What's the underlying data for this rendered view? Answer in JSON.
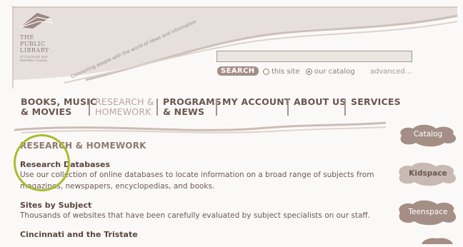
{
  "logo": {
    "line1": "THE",
    "line2": "PUBLIC",
    "line3": "LIBRARY",
    "sub": "of Cincinnati and Hamilton County",
    "tagline": "Connecting people with the world of ideas and information"
  },
  "search": {
    "button_label": "SEARCH",
    "input_value": "",
    "options": [
      {
        "label": "this site",
        "selected": false
      },
      {
        "label": "our catalog",
        "selected": true
      }
    ],
    "advanced_label": "advanced..."
  },
  "nav": {
    "items": [
      {
        "line1": "BOOKS, MUSIC",
        "line2": "& MOVIES",
        "active": false
      },
      {
        "line1": "RESEARCH &",
        "line2": "HOMEWORK",
        "active": true
      },
      {
        "line1": "PROGRAMS",
        "line2": "& NEWS",
        "active": false
      },
      {
        "line1": "MY ACCOUNT",
        "line2": "",
        "active": false
      },
      {
        "line1": "ABOUT US",
        "line2": "",
        "active": false
      },
      {
        "line1": "SERVICES",
        "line2": "",
        "active": false
      }
    ]
  },
  "main": {
    "title": "RESEARCH & HOMEWORK",
    "sections": [
      {
        "heading": "Research Databases",
        "text_lines": [
          "Use our collection of online databases to locate information on a broad range of subjects from",
          "magazines, newspapers, encyclopedias, and books."
        ]
      },
      {
        "heading": "Sites by Subject",
        "text_lines": [
          "Thousands of websites that have been carefully evaluated by subject specialists on our staff."
        ]
      },
      {
        "heading": "Cincinnati and the Tristate",
        "text_lines": []
      }
    ]
  },
  "sidebar": {
    "buttons": [
      {
        "label": "Catalog"
      },
      {
        "label": "Kidspace"
      },
      {
        "label": "Teenspace"
      }
    ]
  },
  "colors": {
    "brand_brown": "#a48e86",
    "highlight_green": "#a9bd2d",
    "background": "#fbf9f7"
  }
}
